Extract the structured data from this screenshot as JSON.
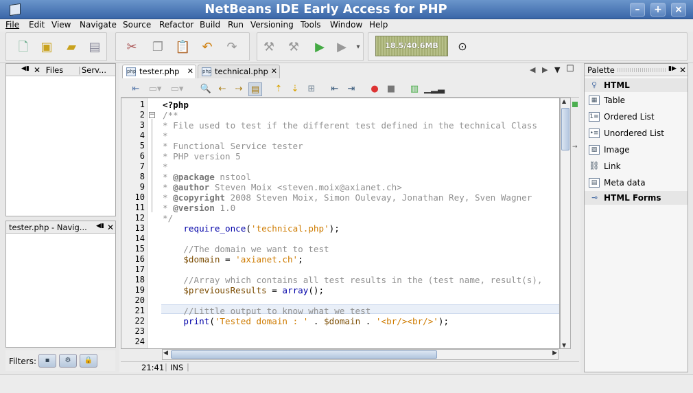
{
  "window": {
    "title": "NetBeans IDE Early Access for PHP"
  },
  "menu": [
    "File",
    "Edit",
    "View",
    "Navigate",
    "Source",
    "Refactor",
    "Build",
    "Run",
    "Versioning",
    "Tools",
    "Window",
    "Help"
  ],
  "toolbar": {
    "memory": "18.5/40.6MB"
  },
  "projects_panel": {
    "tabs": [
      "Files",
      "Serv..."
    ]
  },
  "navigator": {
    "title": "tester.php - Navig..."
  },
  "filters": {
    "label": "Filters:"
  },
  "editor": {
    "tabs": [
      "tester.php",
      "technical.php"
    ],
    "lines": [
      "1",
      "2",
      "3",
      "4",
      "5",
      "6",
      "7",
      "8",
      "9",
      "10",
      "11",
      "12",
      "13",
      "14",
      "15",
      "16",
      "17",
      "18",
      "19",
      "20",
      "21",
      "22",
      "23",
      "24"
    ],
    "code": {
      "l1": "<?php",
      "l2": "/**",
      "l3": "* File used to test if the different test defined in the technical Class",
      "l4": "*",
      "l5": "* Functional Service tester",
      "l6": "* PHP version 5",
      "l7": "*",
      "l8a": "* ",
      "l8b": "@package",
      "l8c": " nstool",
      "l9a": "* ",
      "l9b": "@author",
      "l9c": " Steven Moix <steven.moix@axianet.ch>",
      "l10a": "* ",
      "l10b": "@copyright",
      "l10c": " 2008 Steven Moix, Simon Oulevay, Jonathan Rey, Sven Wagner",
      "l11a": "* ",
      "l11b": "@version",
      "l11c": " 1.0",
      "l12": "*/",
      "l13a": "    require_once",
      "l13b": "(",
      "l13c": "'technical.php'",
      "l13d": ");",
      "l15": "    //The domain we want to test",
      "l16a": "    $domain",
      "l16b": " = ",
      "l16c": "'axianet.ch'",
      "l16d": ";",
      "l18": "    //Array which contains all test results in the (test name, result(s),",
      "l19a": "    $previousResults",
      "l19b": " = ",
      "l19c": "array",
      "l19d": "();",
      "l21": "    //Little output to know what we test",
      "l22a": "    print",
      "l22b": "(",
      "l22c": "'Tested domain : '",
      "l22d": " . ",
      "l22e": "$domain",
      "l22f": " . ",
      "l22g": "'<br/><br/>'",
      "l22h": ");"
    }
  },
  "status": {
    "position": "21:41",
    "mode": "INS"
  },
  "palette": {
    "title": "Palette",
    "html_category": "HTML",
    "items": [
      "Table",
      "Ordered List",
      "Unordered List",
      "Image",
      "Link",
      "Meta data"
    ],
    "forms_category": "HTML Forms"
  }
}
